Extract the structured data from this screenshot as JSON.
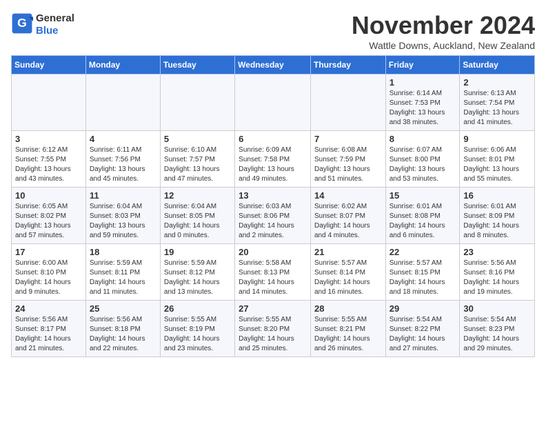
{
  "header": {
    "logo_general": "General",
    "logo_blue": "Blue",
    "title": "November 2024",
    "location": "Wattle Downs, Auckland, New Zealand"
  },
  "days_of_week": [
    "Sunday",
    "Monday",
    "Tuesday",
    "Wednesday",
    "Thursday",
    "Friday",
    "Saturday"
  ],
  "weeks": [
    [
      {
        "day": "",
        "info": ""
      },
      {
        "day": "",
        "info": ""
      },
      {
        "day": "",
        "info": ""
      },
      {
        "day": "",
        "info": ""
      },
      {
        "day": "",
        "info": ""
      },
      {
        "day": "1",
        "info": "Sunrise: 6:14 AM\nSunset: 7:53 PM\nDaylight: 13 hours\nand 38 minutes."
      },
      {
        "day": "2",
        "info": "Sunrise: 6:13 AM\nSunset: 7:54 PM\nDaylight: 13 hours\nand 41 minutes."
      }
    ],
    [
      {
        "day": "3",
        "info": "Sunrise: 6:12 AM\nSunset: 7:55 PM\nDaylight: 13 hours\nand 43 minutes."
      },
      {
        "day": "4",
        "info": "Sunrise: 6:11 AM\nSunset: 7:56 PM\nDaylight: 13 hours\nand 45 minutes."
      },
      {
        "day": "5",
        "info": "Sunrise: 6:10 AM\nSunset: 7:57 PM\nDaylight: 13 hours\nand 47 minutes."
      },
      {
        "day": "6",
        "info": "Sunrise: 6:09 AM\nSunset: 7:58 PM\nDaylight: 13 hours\nand 49 minutes."
      },
      {
        "day": "7",
        "info": "Sunrise: 6:08 AM\nSunset: 7:59 PM\nDaylight: 13 hours\nand 51 minutes."
      },
      {
        "day": "8",
        "info": "Sunrise: 6:07 AM\nSunset: 8:00 PM\nDaylight: 13 hours\nand 53 minutes."
      },
      {
        "day": "9",
        "info": "Sunrise: 6:06 AM\nSunset: 8:01 PM\nDaylight: 13 hours\nand 55 minutes."
      }
    ],
    [
      {
        "day": "10",
        "info": "Sunrise: 6:05 AM\nSunset: 8:02 PM\nDaylight: 13 hours\nand 57 minutes."
      },
      {
        "day": "11",
        "info": "Sunrise: 6:04 AM\nSunset: 8:03 PM\nDaylight: 13 hours\nand 59 minutes."
      },
      {
        "day": "12",
        "info": "Sunrise: 6:04 AM\nSunset: 8:05 PM\nDaylight: 14 hours\nand 0 minutes."
      },
      {
        "day": "13",
        "info": "Sunrise: 6:03 AM\nSunset: 8:06 PM\nDaylight: 14 hours\nand 2 minutes."
      },
      {
        "day": "14",
        "info": "Sunrise: 6:02 AM\nSunset: 8:07 PM\nDaylight: 14 hours\nand 4 minutes."
      },
      {
        "day": "15",
        "info": "Sunrise: 6:01 AM\nSunset: 8:08 PM\nDaylight: 14 hours\nand 6 minutes."
      },
      {
        "day": "16",
        "info": "Sunrise: 6:01 AM\nSunset: 8:09 PM\nDaylight: 14 hours\nand 8 minutes."
      }
    ],
    [
      {
        "day": "17",
        "info": "Sunrise: 6:00 AM\nSunset: 8:10 PM\nDaylight: 14 hours\nand 9 minutes."
      },
      {
        "day": "18",
        "info": "Sunrise: 5:59 AM\nSunset: 8:11 PM\nDaylight: 14 hours\nand 11 minutes."
      },
      {
        "day": "19",
        "info": "Sunrise: 5:59 AM\nSunset: 8:12 PM\nDaylight: 14 hours\nand 13 minutes."
      },
      {
        "day": "20",
        "info": "Sunrise: 5:58 AM\nSunset: 8:13 PM\nDaylight: 14 hours\nand 14 minutes."
      },
      {
        "day": "21",
        "info": "Sunrise: 5:57 AM\nSunset: 8:14 PM\nDaylight: 14 hours\nand 16 minutes."
      },
      {
        "day": "22",
        "info": "Sunrise: 5:57 AM\nSunset: 8:15 PM\nDaylight: 14 hours\nand 18 minutes."
      },
      {
        "day": "23",
        "info": "Sunrise: 5:56 AM\nSunset: 8:16 PM\nDaylight: 14 hours\nand 19 minutes."
      }
    ],
    [
      {
        "day": "24",
        "info": "Sunrise: 5:56 AM\nSunset: 8:17 PM\nDaylight: 14 hours\nand 21 minutes."
      },
      {
        "day": "25",
        "info": "Sunrise: 5:56 AM\nSunset: 8:18 PM\nDaylight: 14 hours\nand 22 minutes."
      },
      {
        "day": "26",
        "info": "Sunrise: 5:55 AM\nSunset: 8:19 PM\nDaylight: 14 hours\nand 23 minutes."
      },
      {
        "day": "27",
        "info": "Sunrise: 5:55 AM\nSunset: 8:20 PM\nDaylight: 14 hours\nand 25 minutes."
      },
      {
        "day": "28",
        "info": "Sunrise: 5:55 AM\nSunset: 8:21 PM\nDaylight: 14 hours\nand 26 minutes."
      },
      {
        "day": "29",
        "info": "Sunrise: 5:54 AM\nSunset: 8:22 PM\nDaylight: 14 hours\nand 27 minutes."
      },
      {
        "day": "30",
        "info": "Sunrise: 5:54 AM\nSunset: 8:23 PM\nDaylight: 14 hours\nand 29 minutes."
      }
    ]
  ]
}
